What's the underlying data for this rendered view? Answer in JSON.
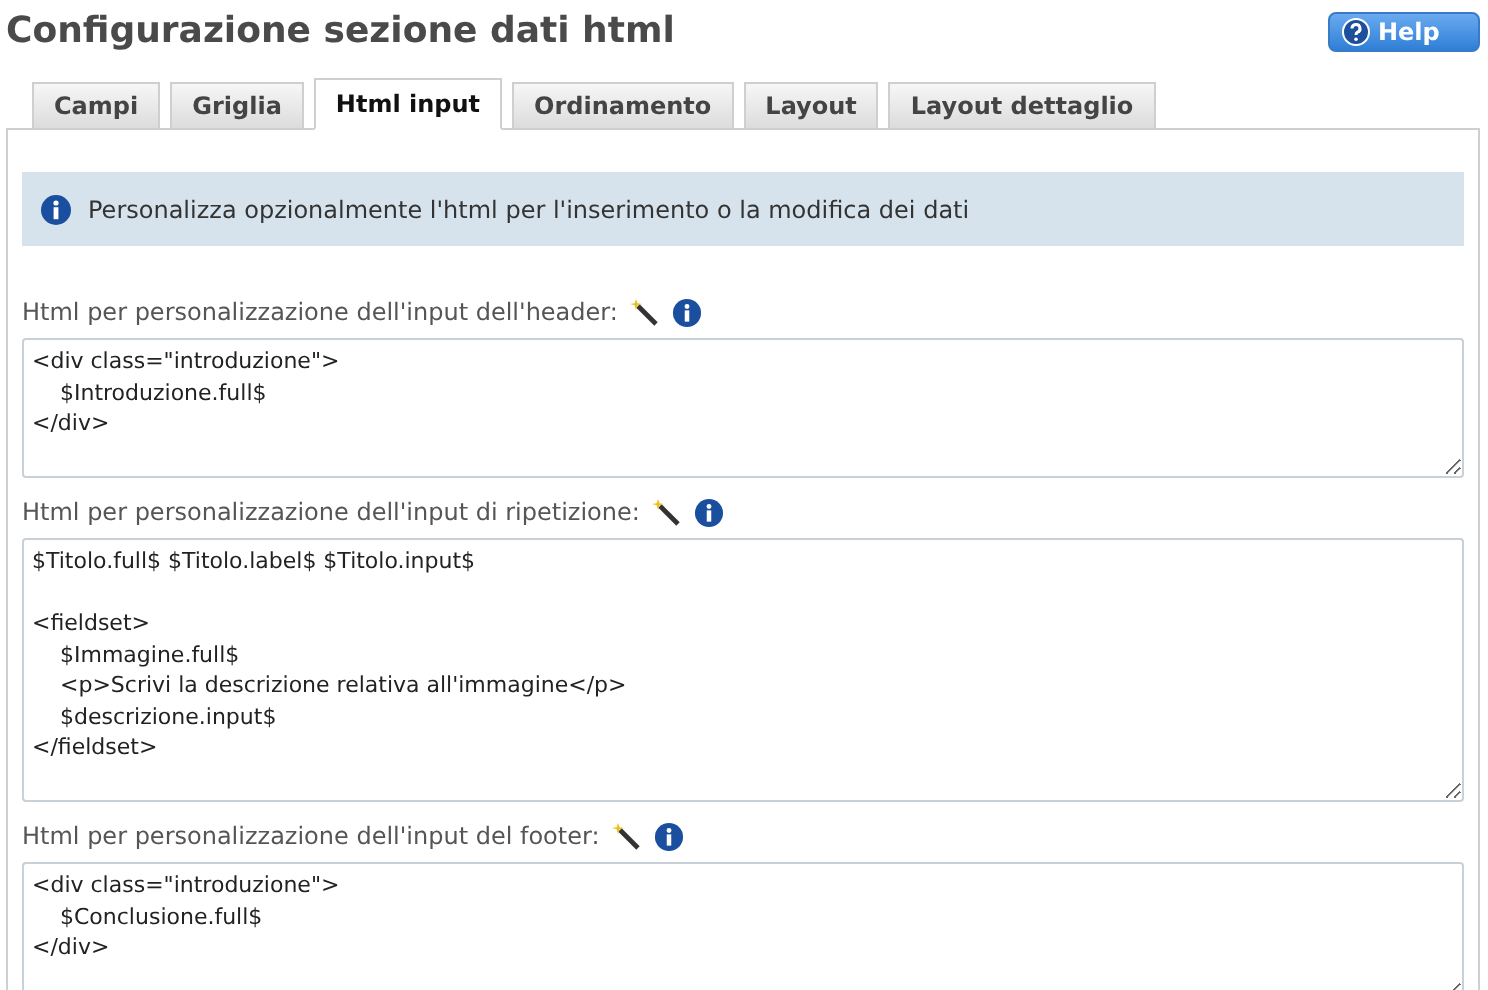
{
  "title": "Configurazione sezione dati html",
  "help_button": {
    "label": "Help"
  },
  "tabs": [
    {
      "label": "Campi",
      "selected": false
    },
    {
      "label": "Griglia",
      "selected": false
    },
    {
      "label": "Html input",
      "selected": true
    },
    {
      "label": "Ordinamento",
      "selected": false
    },
    {
      "label": "Layout",
      "selected": false
    },
    {
      "label": "Layout dettaglio",
      "selected": false
    }
  ],
  "info": "Personalizza opzionalmente l'html per l'inserimento o la modifica dei dati",
  "fields": [
    {
      "label": "Html per personalizzazione dell'input dell'header:",
      "value": "<div class=\"introduzione\">\n    $Introduzione.full$\n</div>"
    },
    {
      "label": "Html per personalizzazione dell'input di ripetizione:",
      "value": "$Titolo.full$ $Titolo.label$ $Titolo.input$\n\n<fieldset>\n    $Immagine.full$\n    <p>Scrivi la descrizione relativa all'immagine</p>\n    $descrizione.input$\n</fieldset>"
    },
    {
      "label": "Html per personalizzazione dell'input del footer:",
      "value": "<div class=\"introduzione\">\n    $Conclusione.full$\n</div>"
    }
  ]
}
